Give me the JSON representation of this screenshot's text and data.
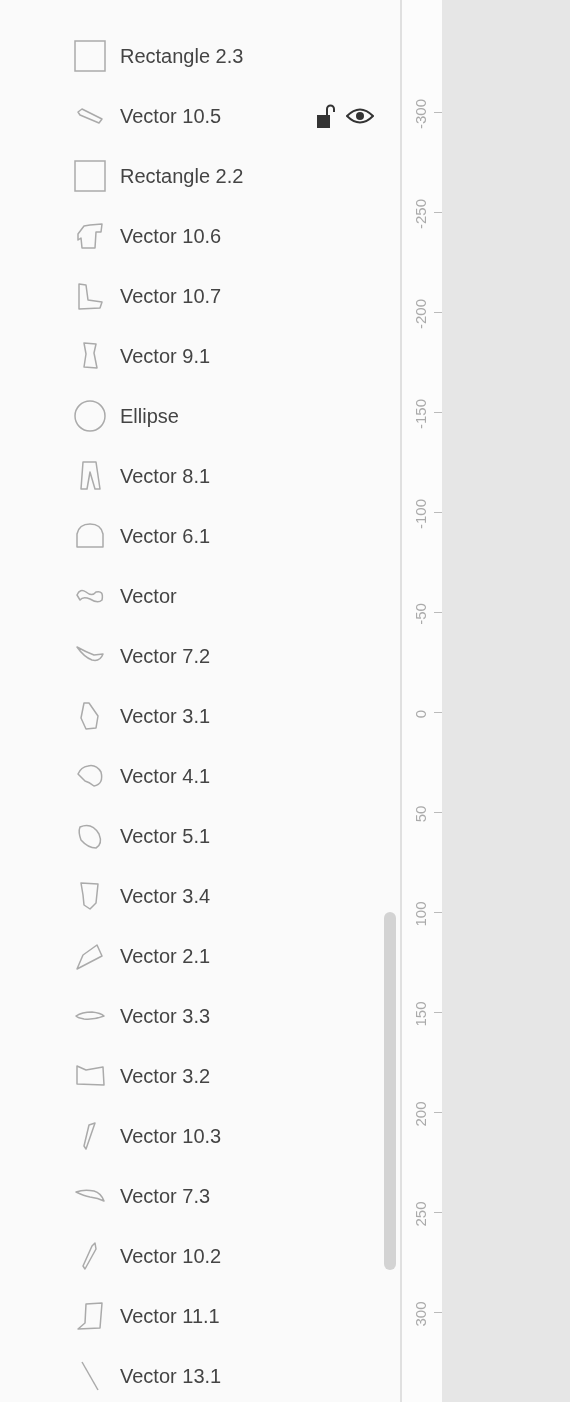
{
  "layers": [
    {
      "name": "Rectangle 2.3",
      "kind": "rectangle",
      "hovered": false
    },
    {
      "name": "Vector 10.5",
      "kind": "vector",
      "hovered": true
    },
    {
      "name": "Rectangle 2.2",
      "kind": "rectangle",
      "hovered": false
    },
    {
      "name": "Vector 10.6",
      "kind": "vector",
      "hovered": false
    },
    {
      "name": "Vector 10.7",
      "kind": "vector",
      "hovered": false
    },
    {
      "name": "Vector 9.1",
      "kind": "vector",
      "hovered": false
    },
    {
      "name": "Ellipse",
      "kind": "ellipse",
      "hovered": false
    },
    {
      "name": "Vector 8.1",
      "kind": "vector",
      "hovered": false
    },
    {
      "name": "Vector 6.1",
      "kind": "vector",
      "hovered": false
    },
    {
      "name": "Vector",
      "kind": "vector",
      "hovered": false
    },
    {
      "name": "Vector 7.2",
      "kind": "vector",
      "hovered": false
    },
    {
      "name": "Vector 3.1",
      "kind": "vector",
      "hovered": false
    },
    {
      "name": "Vector 4.1",
      "kind": "vector",
      "hovered": false
    },
    {
      "name": "Vector 5.1",
      "kind": "vector",
      "hovered": false
    },
    {
      "name": "Vector 3.4",
      "kind": "vector",
      "hovered": false
    },
    {
      "name": "Vector 2.1",
      "kind": "vector",
      "hovered": false
    },
    {
      "name": "Vector 3.3",
      "kind": "vector",
      "hovered": false
    },
    {
      "name": "Vector 3.2",
      "kind": "vector",
      "hovered": false
    },
    {
      "name": "Vector 10.3",
      "kind": "vector",
      "hovered": false
    },
    {
      "name": "Vector 7.3",
      "kind": "vector",
      "hovered": false
    },
    {
      "name": "Vector 10.2",
      "kind": "vector",
      "hovered": false
    },
    {
      "name": "Vector 11.1",
      "kind": "vector",
      "hovered": false
    },
    {
      "name": "Vector 13.1",
      "kind": "vector",
      "hovered": false
    }
  ],
  "ruler": {
    "labels": [
      "-300",
      "-250",
      "-200",
      "-150",
      "-100",
      "-50",
      "0",
      "50",
      "100",
      "150",
      "200",
      "250",
      "300"
    ]
  }
}
